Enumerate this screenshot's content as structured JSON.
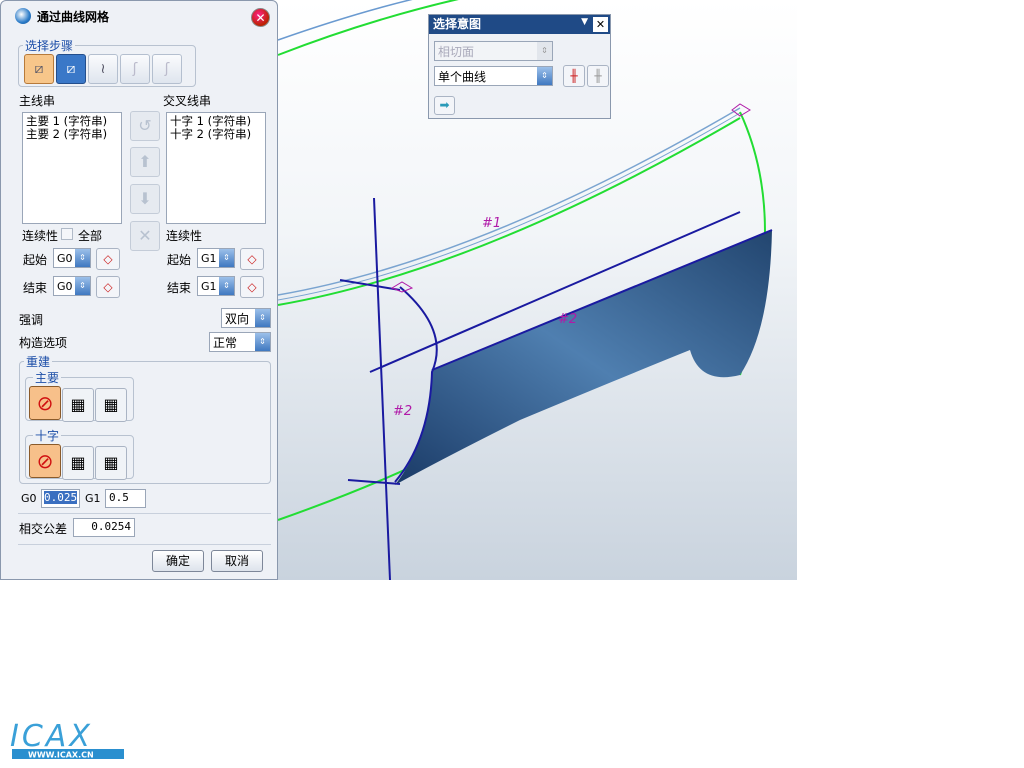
{
  "dialog": {
    "title": "通过曲线网格",
    "steps_legend": "选择步骤",
    "primary_label": "主线串",
    "primary_items": [
      "主要 1 (字符串)",
      "主要 2 (字符串)"
    ],
    "cross_label": "交叉线串",
    "cross_items": [
      "十字 1 (字符串)",
      "十字 2 (字符串)"
    ],
    "continuity_label": "连续性",
    "all_label": "全部",
    "start_label": "起始",
    "end_label": "结束",
    "primary_start": "G0",
    "primary_end": "G0",
    "cross_start": "G1",
    "cross_end": "G1",
    "emphasis_label": "强调",
    "emphasis_value": "双向",
    "construction_label": "构造选项",
    "construction_value": "正常",
    "rebuild_legend": "重建",
    "rebuild_primary": "主要",
    "rebuild_cross": "十字",
    "g0_label": "G0",
    "g0_value": "0.025",
    "g1_label": "G1",
    "g1_value": "0.5",
    "tolerance_label": "相交公差",
    "tolerance_value": "0.0254",
    "ok": "确定",
    "cancel": "取消"
  },
  "selection": {
    "title": "选择意图",
    "face_rule": "相切面",
    "curve_rule": "单个曲线"
  },
  "viewport": {
    "labels": [
      "#1",
      "#2",
      "#2"
    ]
  },
  "logo": {
    "text": "ICAX",
    "url_text": "WWW.ICAX.CN"
  }
}
